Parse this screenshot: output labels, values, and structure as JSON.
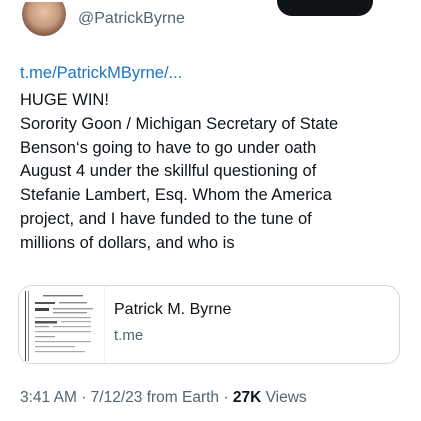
{
  "author": {
    "handle": "@PatrickByrne",
    "avatar_icon": "profile-photo"
  },
  "tweet": {
    "link_text": "t.me/PatrickMByrne/...",
    "lines": [
      "HUGE WIN!",
      "Sorority Goon / Michigan Secretary of State",
      "Benson‘s  going to have to go under oath",
      "August 4 under the skillful questioning of",
      "Stefanie Lambert, Esq. Whom the America",
      "project, and I have funded to the tune of",
      "millions of dollars, and who is"
    ]
  },
  "card": {
    "title": "Patrick M. Byrne",
    "domain": "t.me"
  },
  "meta": {
    "time": "3:41 AM",
    "date": "7/12/23",
    "source": "from Earth",
    "views_count": "27K",
    "views_label": "Views"
  },
  "colors": {
    "link": "#1d74c2",
    "text": "#0f1419",
    "secondary": "#536471",
    "border": "#cfd9de"
  }
}
